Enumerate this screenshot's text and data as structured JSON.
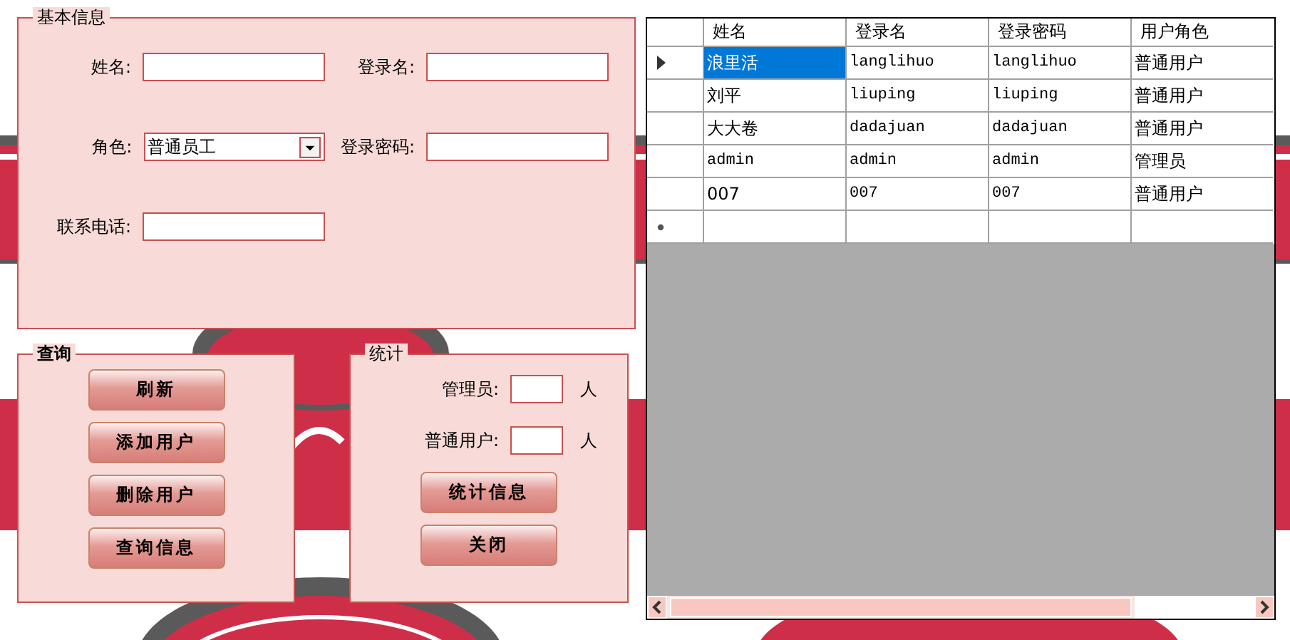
{
  "basic_info": {
    "title": "基本信息",
    "fields": [
      {
        "label": "姓名:",
        "kind": "text"
      },
      {
        "label": "登录名:",
        "kind": "text"
      },
      {
        "label": "角色:",
        "kind": "select",
        "value": "普通员工"
      },
      {
        "label": "登录密码:",
        "kind": "text"
      },
      {
        "label": "联系电话:",
        "kind": "text"
      }
    ]
  },
  "query": {
    "title": "查询",
    "buttons": [
      "刷新",
      "添加用户",
      "删除用户",
      "查询信息"
    ]
  },
  "stats": {
    "title": "统计",
    "rows": [
      {
        "label": "管理员:",
        "unit": "人"
      },
      {
        "label": "普通用户:",
        "unit": "人"
      }
    ],
    "buttons": [
      "统计信息",
      "关闭"
    ]
  },
  "table": {
    "columns": [
      "姓名",
      "登录名",
      "登录密码",
      "用户角色"
    ],
    "rows": [
      {
        "cells": [
          "浪里活",
          "langlihuo",
          "langlihuo",
          "普通用户"
        ],
        "selected": true,
        "current": true
      },
      {
        "cells": [
          "刘平",
          "liuping",
          "liuping",
          "普通用户"
        ],
        "selected": false,
        "current": false
      },
      {
        "cells": [
          "大大卷",
          "dadajuan",
          "dadajuan",
          "普通用户"
        ],
        "selected": false,
        "current": false
      },
      {
        "cells": [
          "admin",
          "admin",
          "admin",
          "管理员"
        ],
        "selected": false,
        "current": false
      },
      {
        "cells": [
          "007",
          "007",
          "007",
          "普通用户"
        ],
        "selected": false,
        "current": false
      }
    ],
    "new_row": true
  }
}
